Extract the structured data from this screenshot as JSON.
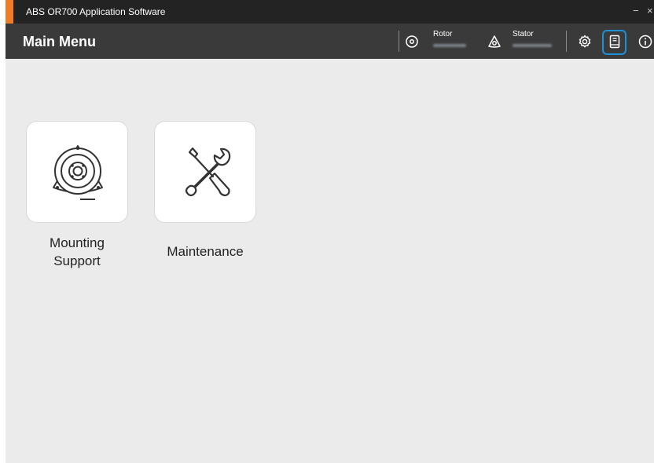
{
  "titlebar": {
    "app_title": "ABS OR700 Application Software",
    "minimize": "−",
    "close": "×"
  },
  "header": {
    "title": "Main Menu",
    "rotor_label": "Rotor",
    "stator_label": "Stator"
  },
  "tiles": [
    {
      "label_line1": "Mounting",
      "label_line2": "Support",
      "icon": "mounting-support-icon"
    },
    {
      "label": "Maintenance",
      "icon": "wrench-screwdriver-icon"
    }
  ],
  "colors": {
    "accent": "#f07c26",
    "titlebar": "#232323",
    "header": "#3a3a3a",
    "background": "#ebebeb",
    "highlight": "#1e90d8"
  }
}
